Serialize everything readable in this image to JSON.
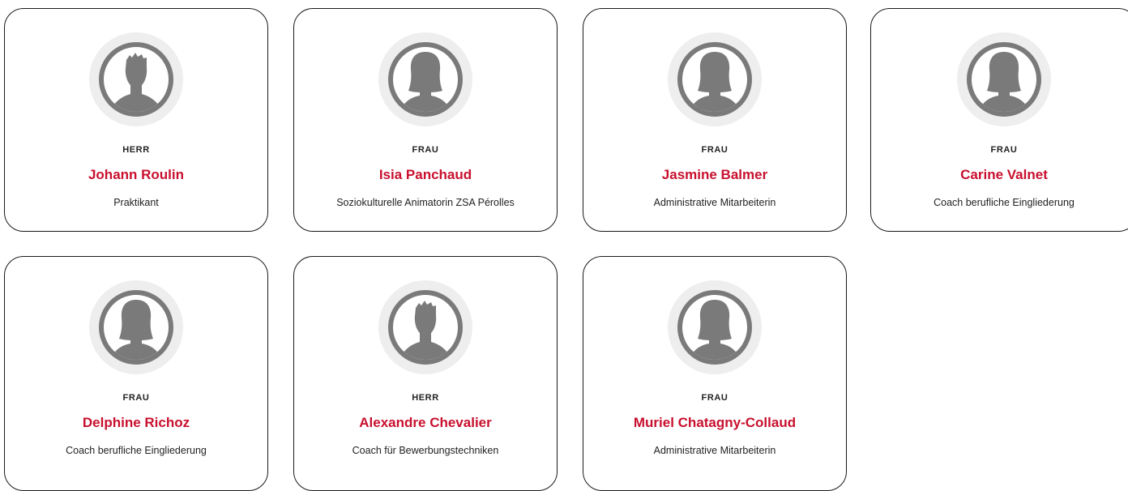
{
  "colors": {
    "accent_name": "#c8102e",
    "text": "#222222",
    "card_border": "#1a1a1a",
    "avatar_ring": "#eeeeee",
    "avatar_fill": "#7a7a7a"
  },
  "staff": [
    {
      "salutation": "HERR",
      "name": "Johann Roulin",
      "role": "Praktikant",
      "avatar_icon": "male-avatar-icon"
    },
    {
      "salutation": "FRAU",
      "name": "Isia Panchaud",
      "role": "Soziokulturelle Animatorin ZSA Pérolles",
      "avatar_icon": "female-avatar-icon"
    },
    {
      "salutation": "FRAU",
      "name": "Jasmine Balmer",
      "role": "Administrative Mitarbeiterin",
      "avatar_icon": "female-avatar-icon"
    },
    {
      "salutation": "FRAU",
      "name": "Carine Valnet",
      "role": "Coach berufliche Eingliederung",
      "avatar_icon": "female-avatar-icon"
    },
    {
      "salutation": "FRAU",
      "name": "Delphine Richoz",
      "role": "Coach berufliche Eingliederung",
      "avatar_icon": "female-avatar-icon"
    },
    {
      "salutation": "HERR",
      "name": "Alexandre Chevalier",
      "role": "Coach für Bewerbungstechniken",
      "avatar_icon": "male-avatar-icon"
    },
    {
      "salutation": "FRAU",
      "name": "Muriel Chatagny-Collaud",
      "role": "Administrative Mitarbeiterin",
      "avatar_icon": "female-avatar-icon"
    }
  ]
}
